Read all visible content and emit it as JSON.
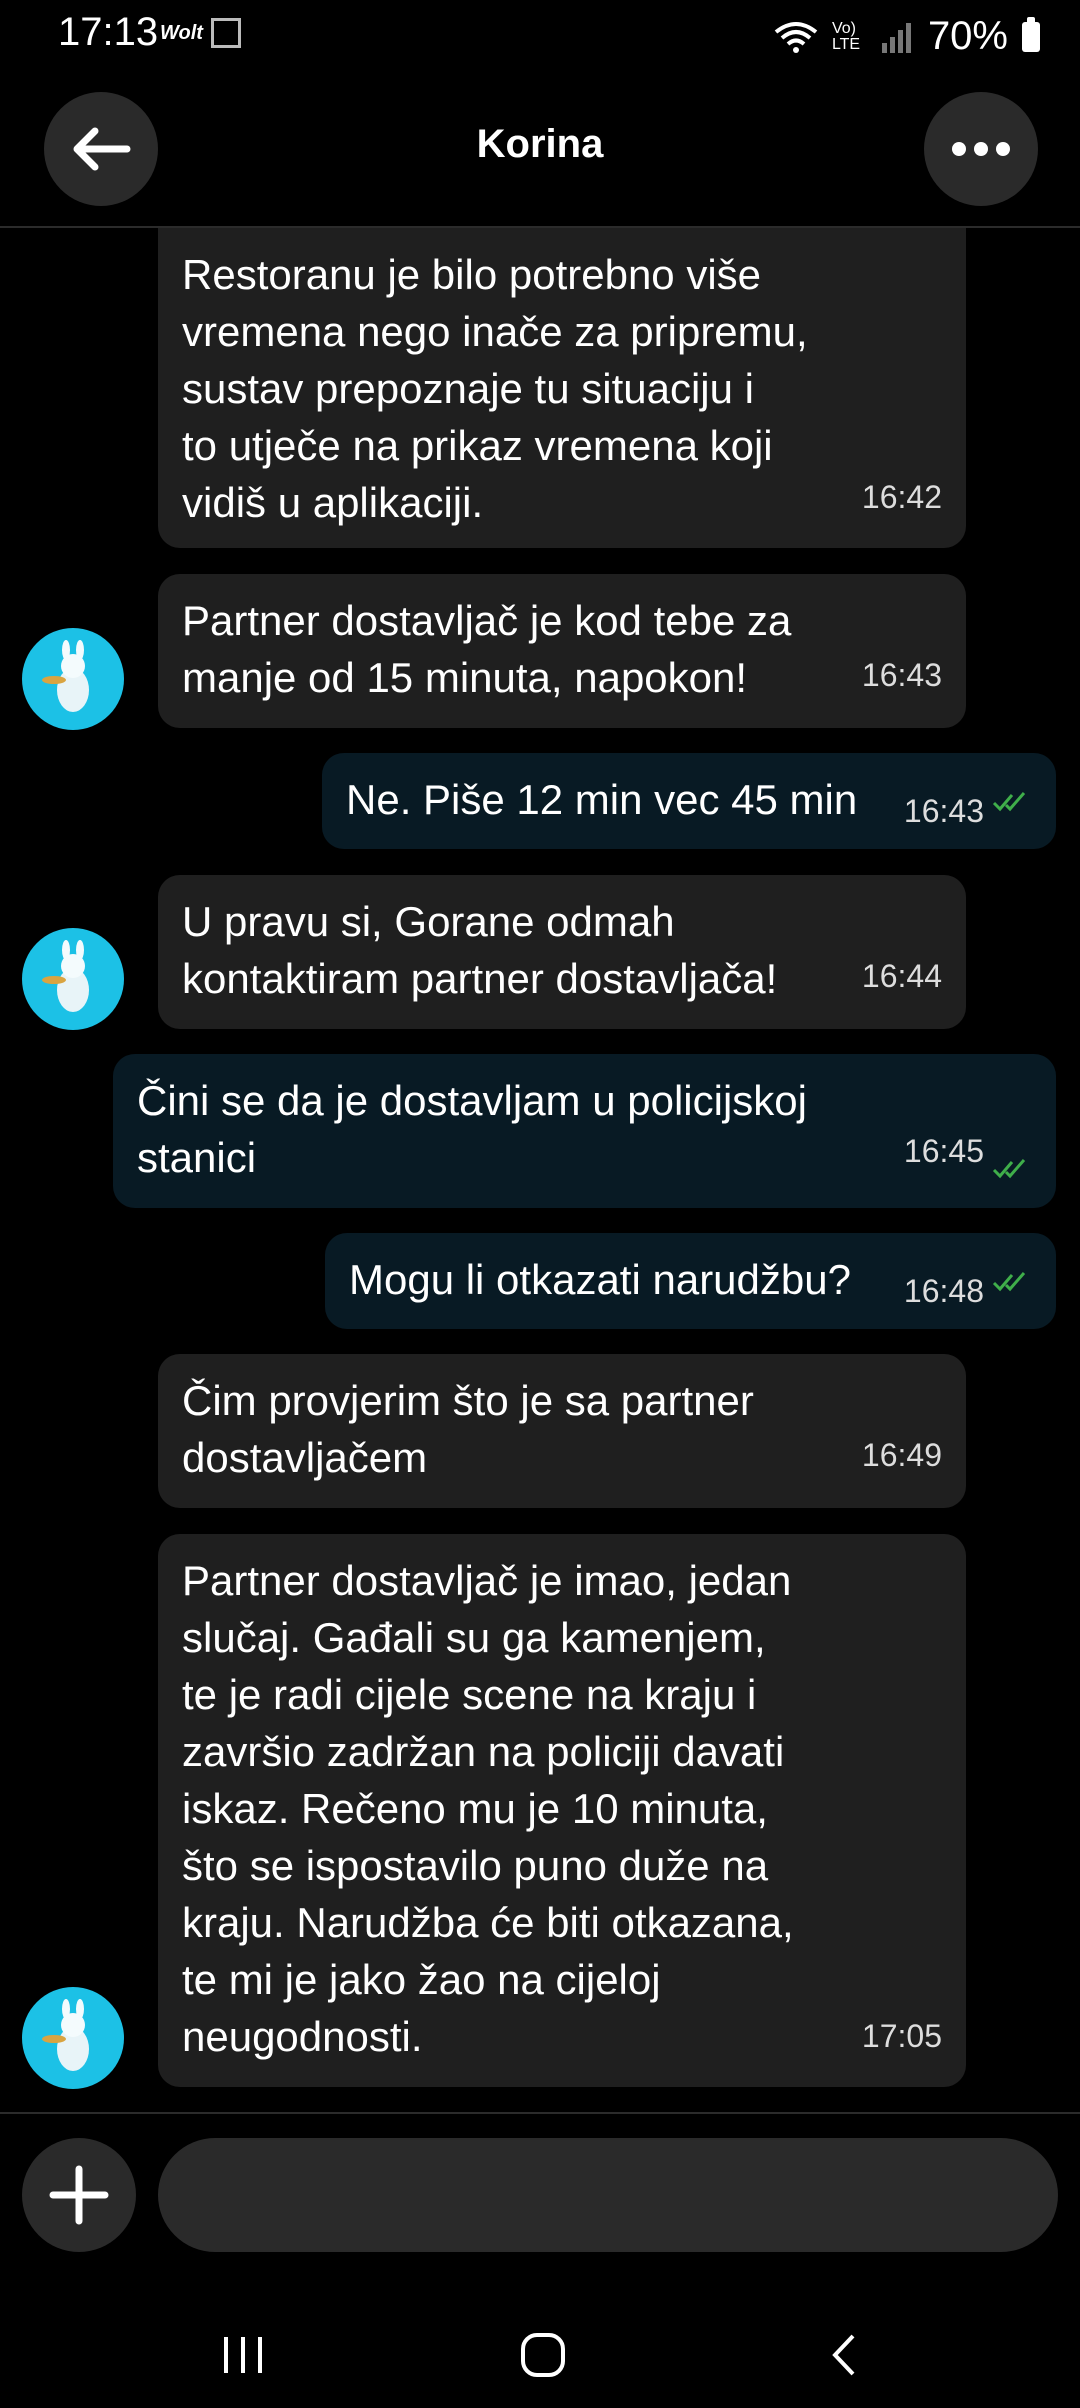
{
  "status_bar": {
    "time": "17:13",
    "wolt_label": "Wolt",
    "network": "Vo) LTE",
    "battery": "70%"
  },
  "header": {
    "title": "Korina"
  },
  "messages": [
    {
      "text": "Restoranu je bilo potrebno više\nvremena nego inače za pripremu,\nsustav prepoznaje tu situaciju i\nto utječe na prikaz vremena koji\nvidiš u aplikaciji.",
      "time": "16:42"
    },
    {
      "text": "Partner dostavljač je kod tebe za\nmanje od 15 minuta, napokon!",
      "time": "16:43"
    },
    {
      "text": "Ne. Piše 12 min vec 45 min",
      "time": "16:43"
    },
    {
      "text": "U pravu si, Gorane odmah\nkontaktiram partner dostavljača!",
      "time": "16:44"
    },
    {
      "text": "Čini se da je dostavljam u policijskoj\nstanici",
      "time": "16:45"
    },
    {
      "text": "Mogu li otkazati narudžbu?",
      "time": "16:48"
    },
    {
      "text": "Čim provjerim što je sa partner\ndostavljačem",
      "time": "16:49"
    },
    {
      "text": "Partner dostavljač je imao, jedan\nslučaj. Gađali su ga kamenjem,\nte je radi cijele scene na kraju i\nzavršio zadržan na policiji davati\niskaz. Rečeno mu je 10 minuta,\nšto se ispostavilo puno duže na\nkraju. Narudžba će biti otkazana,\nte mi je jako žao na cijeloj\nneugodnosti.",
      "time": "17:05"
    }
  ],
  "composer": {
    "placeholder": ""
  },
  "colors": {
    "incoming_bubble": "#1f1f1f",
    "outgoing_bubble": "#081a24",
    "read_check": "#3fae4a",
    "avatar_bg": "#1cc1e6"
  }
}
